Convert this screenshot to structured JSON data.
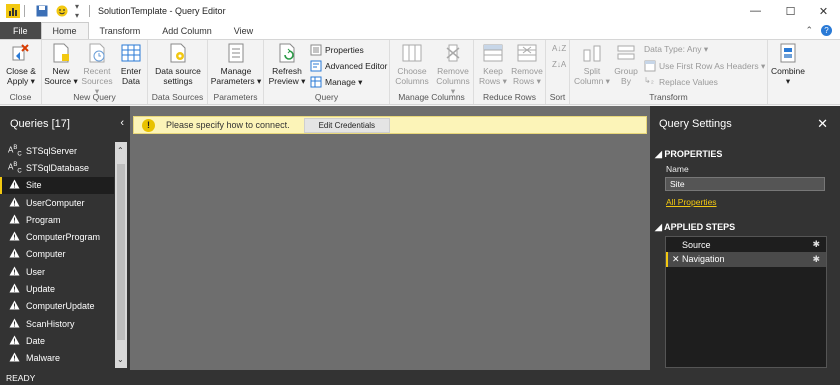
{
  "window": {
    "title": "SolutionTemplate - Query Editor",
    "minimize": "—",
    "maximize": "☐",
    "close": "✕"
  },
  "tabs": {
    "file": "File",
    "home": "Home",
    "transform": "Transform",
    "add_column": "Add Column",
    "view": "View"
  },
  "ribbon": {
    "close_apply": {
      "line1": "Close &",
      "line2": "Apply ▾"
    },
    "new_source": {
      "line1": "New",
      "line2": "Source ▾"
    },
    "recent_sources": {
      "line1": "Recent",
      "line2": "Sources ▾"
    },
    "enter_data": {
      "line1": "Enter",
      "line2": "Data"
    },
    "data_source_settings": {
      "line1": "Data source",
      "line2": "settings"
    },
    "manage_parameters": {
      "line1": "Manage",
      "line2": "Parameters ▾"
    },
    "refresh_preview": {
      "line1": "Refresh",
      "line2": "Preview ▾"
    },
    "properties": "Properties",
    "advanced_editor": "Advanced Editor",
    "manage": "Manage ▾",
    "choose_columns": {
      "line1": "Choose",
      "line2": "Columns"
    },
    "remove_columns": {
      "line1": "Remove",
      "line2": "Columns ▾"
    },
    "keep_rows": {
      "line1": "Keep",
      "line2": "Rows ▾"
    },
    "remove_rows": {
      "line1": "Remove",
      "line2": "Rows ▾"
    },
    "split_column": {
      "line1": "Split",
      "line2": "Column ▾"
    },
    "group_by": {
      "line1": "Group",
      "line2": "By"
    },
    "data_type": "Data Type: Any ▾",
    "use_first_row": "Use First Row As Headers ▾",
    "replace_values": "Replace Values",
    "combine": {
      "line1": "Combine",
      "line2": "▾"
    },
    "groups": {
      "close": "Close",
      "new_query": "New Query",
      "data_sources": "Data Sources",
      "parameters": "Parameters",
      "query": "Query",
      "manage_columns": "Manage Columns",
      "reduce_rows": "Reduce Rows",
      "sort": "Sort",
      "transform": "Transform"
    }
  },
  "queries": {
    "title": "Queries [17]",
    "collapse": "‹",
    "items": [
      {
        "label": "STSqlServer",
        "icon": "ABC"
      },
      {
        "label": "STSqlDatabase",
        "icon": "ABC"
      },
      {
        "label": "Site",
        "icon": "warning"
      },
      {
        "label": "UserComputer",
        "icon": "warning"
      },
      {
        "label": "Program",
        "icon": "warning"
      },
      {
        "label": "ComputerProgram",
        "icon": "warning"
      },
      {
        "label": "Computer",
        "icon": "warning"
      },
      {
        "label": "User",
        "icon": "warning"
      },
      {
        "label": "Update",
        "icon": "warning"
      },
      {
        "label": "ComputerUpdate",
        "icon": "warning"
      },
      {
        "label": "ScanHistory",
        "icon": "warning"
      },
      {
        "label": "Date",
        "icon": "warning"
      },
      {
        "label": "Malware",
        "icon": "warning"
      }
    ],
    "selected_index": 2
  },
  "warning": {
    "icon": "!",
    "text": "Please specify how to connect.",
    "button": "Edit Credentials"
  },
  "settings": {
    "title": "Query Settings",
    "close": "✕",
    "properties_header": "◢ PROPERTIES",
    "name_label": "Name",
    "name_value": "Site",
    "all_properties": "All Properties",
    "applied_steps_header": "◢ APPLIED STEPS",
    "steps": [
      {
        "label": "Source",
        "gear": "✱"
      },
      {
        "label": "✕ Navigation",
        "gear": "✱"
      }
    ]
  },
  "status": "READY",
  "colors": {
    "accent": "#f2c811",
    "panel": "#333333",
    "canvas": "#6e6e6e",
    "warn_bg": "#fcf4b8"
  }
}
